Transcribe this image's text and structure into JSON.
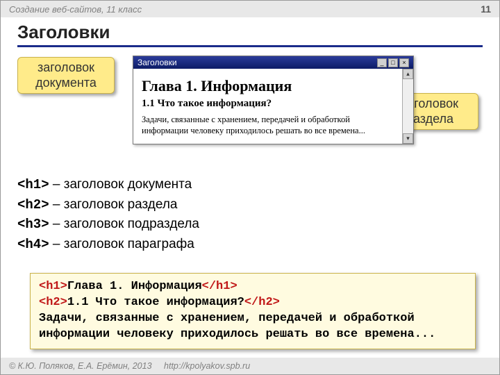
{
  "header": {
    "course": "Создание веб-сайтов, 11 класс",
    "page": "11"
  },
  "title": "Заголовки",
  "callouts": {
    "doc": "заголовок документа",
    "section": "заголовок раздела"
  },
  "browser": {
    "title": "Заголовки",
    "h1": "Глава 1. Информация",
    "h2": "1.1 Что такое информация?",
    "p": "Задачи, связанные с хранением, передачей и обработкой информации человеку приходилось решать во все времена..."
  },
  "defs": [
    {
      "tag": "<h1>",
      "desc": " – заголовок документа"
    },
    {
      "tag": "<h2>",
      "desc": " – заголовок раздела"
    },
    {
      "tag": "<h3>",
      "desc": " – заголовок подраздела"
    },
    {
      "tag": "<h4>",
      "desc": " – заголовок параграфа"
    }
  ],
  "code": {
    "l1_open": "<h1>",
    "l1_text": "Глава 1. Информация",
    "l1_close": "</h1>",
    "l2_open": "<h2>",
    "l2_text": "1.1 Что такое информация?",
    "l2_close": "</h2>",
    "l3": "Задачи, связанные с хранением, передачей и обработкой информации человеку приходилось решать во все времена..."
  },
  "footer": {
    "copyright": "© К.Ю. Поляков, Е.А. Ерёмин, 2013",
    "url": "http://kpolyakov.spb.ru"
  }
}
